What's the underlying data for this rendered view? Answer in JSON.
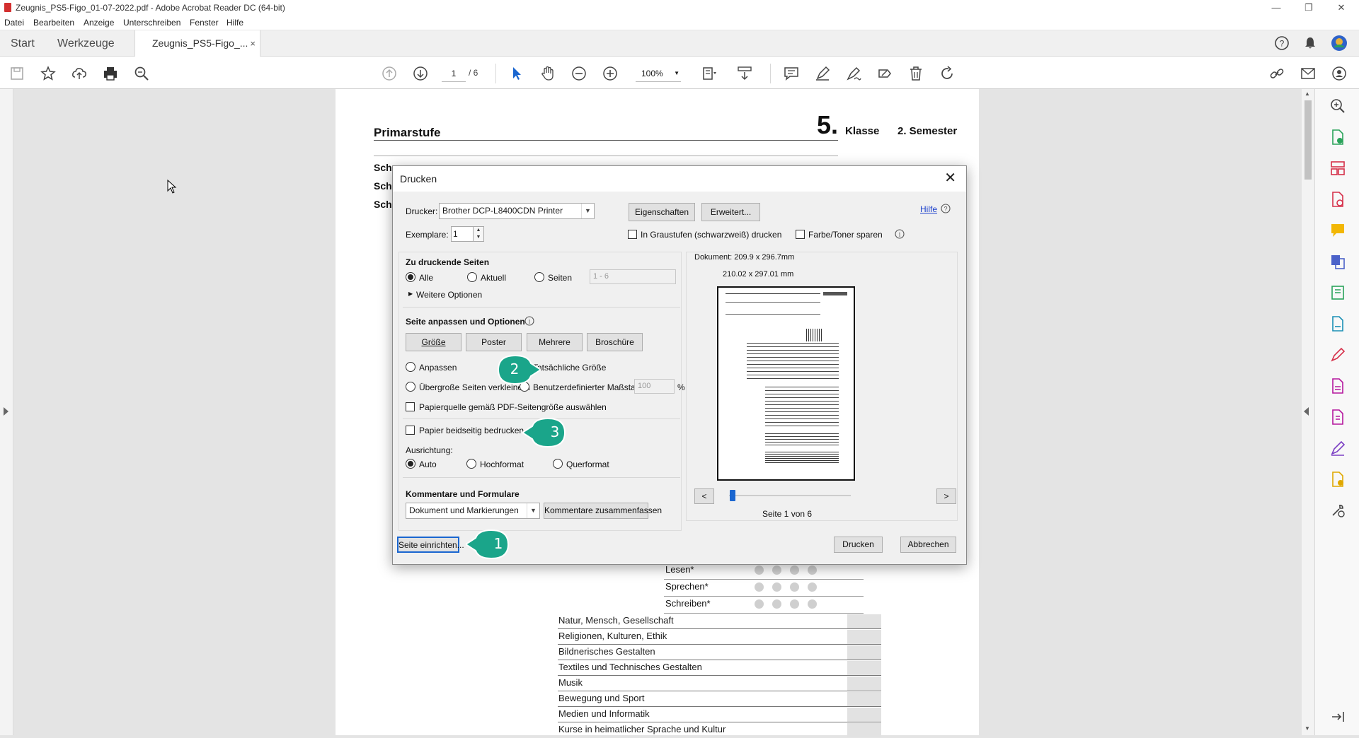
{
  "window": {
    "title": "Zeugnis_PS5-Figo_01-07-2022.pdf - Adobe Acrobat Reader DC (64-bit)"
  },
  "menu": [
    "Datei",
    "Bearbeiten",
    "Anzeige",
    "Unterschreiben",
    "Fenster",
    "Hilfe"
  ],
  "tabs": {
    "start": "Start",
    "tools": "Werkzeuge",
    "doc": "Zeugnis_PS5-Figo_...",
    "close": "×"
  },
  "toolbar": {
    "page_current": "1",
    "page_total": "/ 6",
    "zoom": "100%"
  },
  "document": {
    "heading": "Primarstufe",
    "grade_number": "5.",
    "grade_label": "Klasse",
    "semester": "2. Semester",
    "left_stubs": [
      "Sch",
      "Sch",
      "Sch"
    ],
    "language_rows": [
      "Lesen*",
      "Sprechen*",
      "Schreiben*"
    ],
    "subjects": [
      "Natur, Mensch, Gesellschaft",
      "Religionen, Kulturen, Ethik",
      "Bildnerisches Gestalten",
      "Textiles und Technisches Gestalten",
      "Musik",
      "Bewegung und Sport",
      "Medien und Informatik",
      "Kurse in heimatlicher Sprache und Kultur"
    ]
  },
  "dialog": {
    "title": "Drucken",
    "close": "✕",
    "printer_label": "Drucker:",
    "printer_value": "Brother DCP-L8400CDN Printer",
    "properties_btn": "Eigenschaften",
    "advanced_btn": "Erweitert...",
    "help_link": "Hilfe",
    "copies_label": "Exemplare:",
    "copies_value": "1",
    "grayscale_label": "In Graustufen (schwarzweiß) drucken",
    "grayscale_checked": false,
    "toner_label": "Farbe/Toner sparen",
    "toner_checked": false,
    "pages_group_title": "Zu druckende Seiten",
    "pages_all": "Alle",
    "pages_current": "Aktuell",
    "pages_range": "Seiten",
    "pages_range_placeholder": "1 - 6",
    "more_options": "Weitere Optionen",
    "fit_group_title": "Seite anpassen und Optionen",
    "size_btn": "Größe",
    "poster_btn": "Poster",
    "multiple_btn": "Mehrere",
    "booklet_btn": "Broschüre",
    "fit_label": "Anpassen",
    "actual_size_label": "Tatsächliche Größe",
    "shrink_label": "Übergroße Seiten verkleinern",
    "custom_scale_label": "Benutzerdefinierter Maßstab:",
    "custom_scale_value": "100",
    "percent": "%",
    "paper_source_label": "Papierquelle gemäß PDF-Seitengröße auswählen",
    "duplex_label": "Papier beidseitig bedrucken",
    "orientation_label": "Ausrichtung:",
    "orient_auto": "Auto",
    "orient_portrait": "Hochformat",
    "orient_landscape": "Querformat",
    "comments_group_title": "Kommentare und Formulare",
    "comments_value": "Dokument und Markierungen",
    "summarize_btn": "Kommentare zusammenfassen",
    "doc_size": "Dokument: 209.9 x 296.7mm",
    "paper_size": "210.02 x 297.01 mm",
    "prev_btn": "<",
    "next_btn": ">",
    "page_indicator": "Seite 1 von 6",
    "page_setup_btn": "Seite einrichten...",
    "print_btn": "Drucken",
    "cancel_btn": "Abbrechen"
  },
  "callouts": {
    "one": "1",
    "two": "2",
    "three": "3",
    "color": "#1aa58a"
  }
}
